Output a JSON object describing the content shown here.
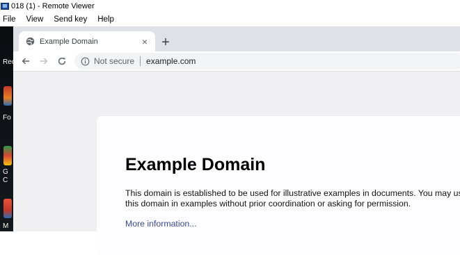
{
  "window": {
    "title": "018 (1) - Remote Viewer",
    "menu": [
      "File",
      "View",
      "Send key",
      "Help"
    ]
  },
  "browser": {
    "tab": {
      "title": "Example Domain",
      "close": "×"
    },
    "new_tab": "+",
    "omnibox": {
      "security_label": "Not secure",
      "url": "example.com"
    }
  },
  "page": {
    "heading": "Example Domain",
    "paragraph": "This domain is established to be used for illustrative examples in documents. You may use this domain in examples without prior coordination or asking for permission.",
    "link": "More information..."
  },
  "desktop": {
    "labels": [
      "Rec",
      "Fo",
      "G",
      "C",
      "M"
    ]
  },
  "colors": {
    "tabstrip": "#dee1e6",
    "viewport_bg": "#f0f0f2",
    "link": "#38488f"
  }
}
